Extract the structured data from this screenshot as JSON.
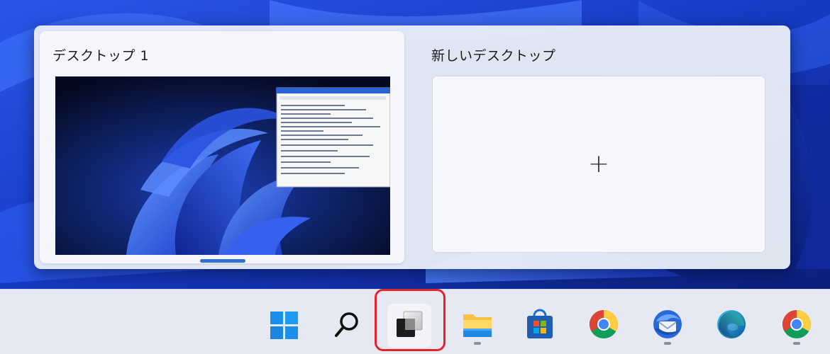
{
  "task_view": {
    "desktops": [
      {
        "label": "デスクトップ 1"
      }
    ],
    "new_desktop": {
      "label": "新しいデスクトップ",
      "add_symbol": "+"
    }
  },
  "taskbar": {
    "items": [
      {
        "name": "start",
        "icon": "windows-logo-icon"
      },
      {
        "name": "search",
        "icon": "search-icon"
      },
      {
        "name": "task-view",
        "icon": "task-view-icon",
        "highlighted": true
      },
      {
        "name": "file-explorer",
        "icon": "folder-icon"
      },
      {
        "name": "microsoft-store",
        "icon": "store-icon"
      },
      {
        "name": "chrome",
        "icon": "chrome-icon"
      },
      {
        "name": "thunderbird",
        "icon": "thunderbird-icon"
      },
      {
        "name": "edge",
        "icon": "edge-icon"
      },
      {
        "name": "chrome-2",
        "icon": "chrome-icon"
      }
    ]
  },
  "colors": {
    "accent": "#2f6fd6",
    "highlight_outline": "#e0252b"
  }
}
